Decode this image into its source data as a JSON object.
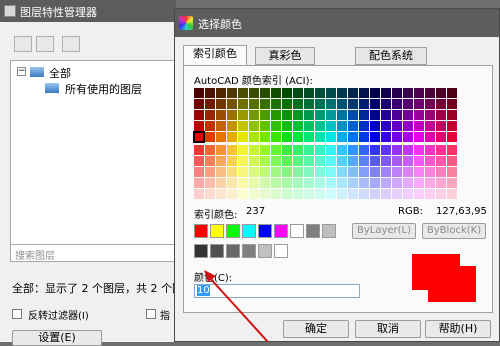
{
  "left_window": {
    "title": "图层特性管理器",
    "tree_root": "全部",
    "tree_child": "所有使用的图层",
    "search_placeholder": "搜索图层",
    "status_text": "全部：显示了 2 个图层，共 2 个图",
    "invert_filter_label": "反转过滤器(I)",
    "cut_label": "指",
    "settings_label": "设置(E)"
  },
  "dialog": {
    "title": "选择颜色",
    "tabs": [
      {
        "label": "索引颜色",
        "active": true
      },
      {
        "label": "真彩色",
        "active": false
      },
      {
        "label": "配色系统",
        "active": false
      }
    ],
    "aci_label": "AutoCAD 颜色索引 (ACI):",
    "index_color_label": "索引颜色:",
    "index_color_value": "237",
    "rgb_label": "RGB:",
    "rgb_value": "127,63,95",
    "bylayer_label": "ByLayer(L)",
    "byblock_label": "ByBlock(K)",
    "color_field_label": "颜色(C):",
    "color_field_value": "10",
    "preview_color": "#ff0000",
    "buttons": {
      "ok": "确定",
      "cancel": "取消",
      "help": "帮助(H)"
    }
  },
  "palette": {
    "standard_colors": [
      "#ff0000",
      "#ffff00",
      "#00ff00",
      "#00ffff",
      "#0000ff",
      "#ff00ff",
      "#ffffff",
      "#808080",
      "#c0c0c0"
    ],
    "gray_colors": [
      "#333333",
      "#505050",
      "#696969",
      "#808080",
      "#c0c0c0",
      "#ffffff"
    ]
  },
  "annotation": {
    "arrow_color": "#d01010"
  }
}
